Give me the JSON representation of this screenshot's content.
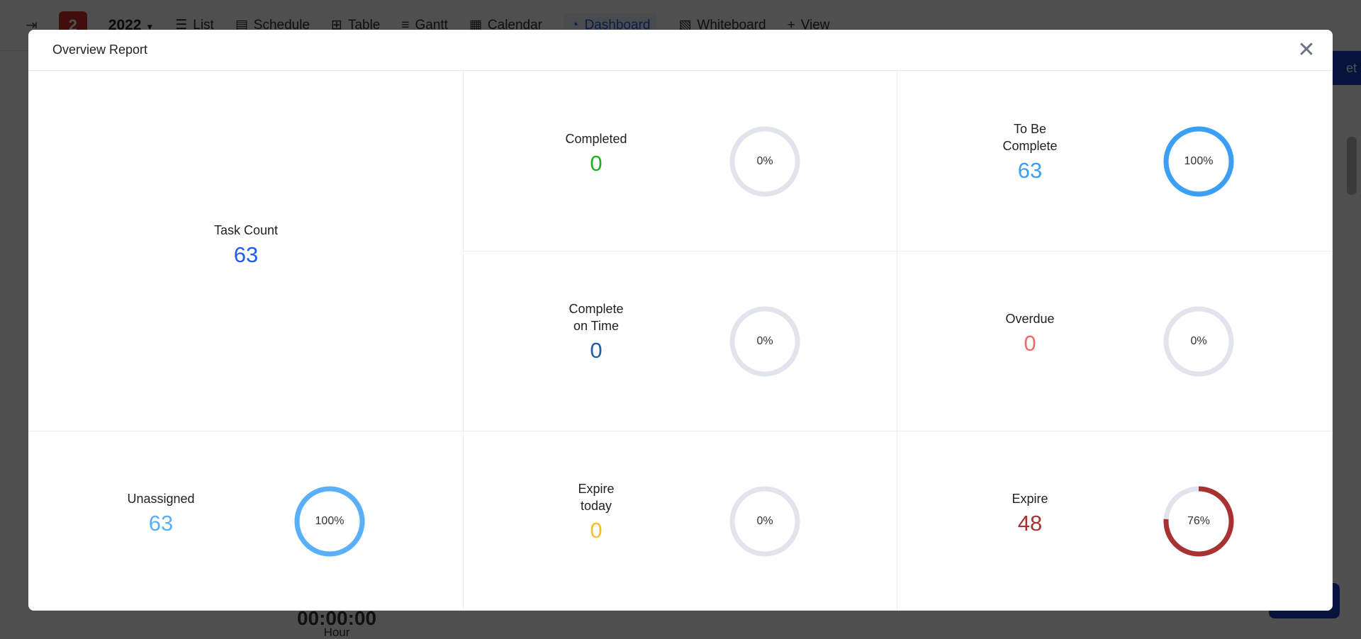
{
  "toolbar": {
    "badge": "2",
    "year": "2022",
    "items": [
      {
        "label": "List",
        "icon": "list-icon"
      },
      {
        "label": "Schedule",
        "icon": "schedule-icon"
      },
      {
        "label": "Table",
        "icon": "table-icon"
      },
      {
        "label": "Gantt",
        "icon": "gantt-icon"
      },
      {
        "label": "Calendar",
        "icon": "calendar-icon"
      },
      {
        "label": "Dashboard",
        "icon": "dashboard-icon",
        "active": true
      },
      {
        "label": "Whiteboard",
        "icon": "whiteboard-icon"
      },
      {
        "label": "View",
        "icon": "plus-icon"
      }
    ]
  },
  "background": {
    "time": "00:00:00",
    "hour_label": "Hour",
    "side_button": "et"
  },
  "modal": {
    "title": "Overview Report",
    "close_icon": "close-icon",
    "task_count": {
      "label": "Task Count",
      "value": "63",
      "color": "#1f5cf5"
    },
    "cards": [
      {
        "label": "Completed",
        "value": "0",
        "percent": 0,
        "percent_label": "0%",
        "color": "#22b022"
      },
      {
        "label": "To Be Complete",
        "value": "63",
        "percent": 100,
        "percent_label": "100%",
        "color": "#3a9ff5"
      },
      {
        "label": "Complete on Time",
        "value": "0",
        "percent": 0,
        "percent_label": "0%",
        "color": "#1e5ea8"
      },
      {
        "label": "Overdue",
        "value": "0",
        "percent": 0,
        "percent_label": "0%",
        "color": "#ef6b6b"
      },
      {
        "label": "Unassigned",
        "value": "63",
        "percent": 100,
        "percent_label": "100%",
        "color": "#5ab0f8"
      },
      {
        "label": "Expire today",
        "value": "0",
        "percent": 0,
        "percent_label": "0%",
        "color": "#f5bf2a"
      },
      {
        "label": "Expire",
        "value": "48",
        "percent": 76,
        "percent_label": "76%",
        "color": "#a83232"
      }
    ],
    "track_color": "#e1e4ec"
  }
}
